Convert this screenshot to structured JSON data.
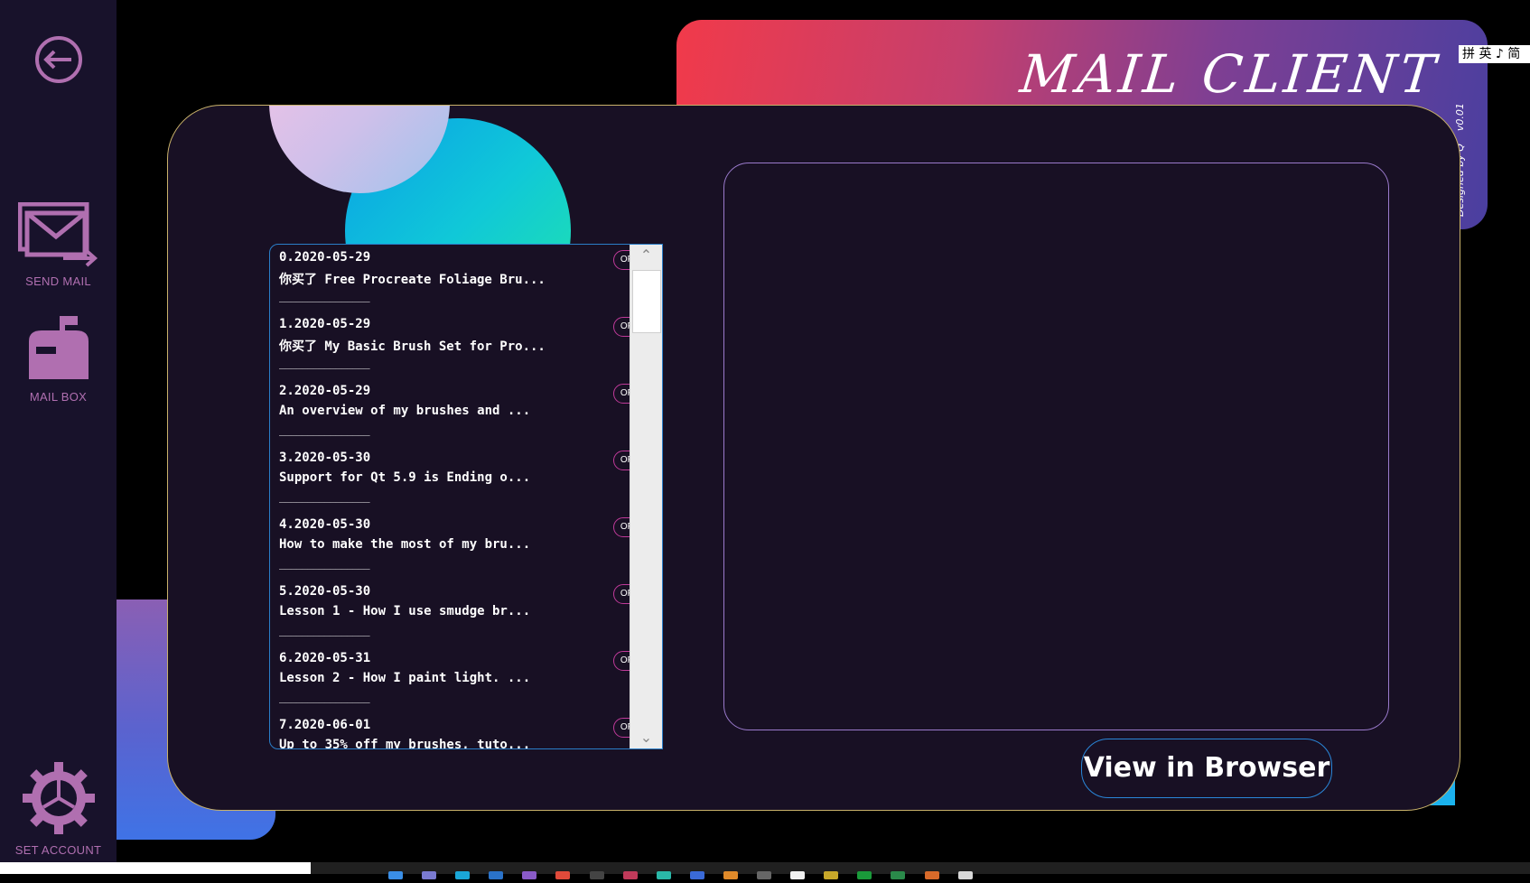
{
  "app": {
    "title": "MAIL CLIENT",
    "credit": "Designed by Q",
    "version": "v0.01",
    "ime_indicator": "拼 英 ♪ 简"
  },
  "sidebar": {
    "items": [
      {
        "label": "",
        "icon": "back-icon"
      },
      {
        "label": "SEND MAIL",
        "icon": "send-mail-icon"
      },
      {
        "label": "MAIL BOX",
        "icon": "mailbox-icon"
      },
      {
        "label": "SET ACCOUNT",
        "icon": "gear-icon"
      }
    ]
  },
  "mail_list": {
    "open_label": "OPEN",
    "separator": "________________",
    "items": [
      {
        "date": "0.2020-05-29",
        "subject": "你买了 Free Procreate Foliage Bru..."
      },
      {
        "date": "1.2020-05-29",
        "subject": "你买了 My Basic Brush Set for Pro..."
      },
      {
        "date": "2.2020-05-29",
        "subject": "An overview of my brushes and ..."
      },
      {
        "date": "3.2020-05-30",
        "subject": "Support for Qt 5.9 is Ending o..."
      },
      {
        "date": "4.2020-05-30",
        "subject": "How to make the most of my bru..."
      },
      {
        "date": "5.2020-05-30",
        "subject": "Lesson 1 - How I use smudge br..."
      },
      {
        "date": "6.2020-05-31",
        "subject": "Lesson 2 - How I paint light. ..."
      },
      {
        "date": "7.2020-06-01",
        "subject": "Up to 35% off my brushes, tuto..."
      }
    ]
  },
  "reader": {
    "view_in_browser_label": "View in Browser"
  },
  "colors": {
    "sidebar_bg": "#18122b",
    "accent_pink": "#b06fb0",
    "panel_bg": "#181024",
    "open_border": "#c03a9a"
  }
}
